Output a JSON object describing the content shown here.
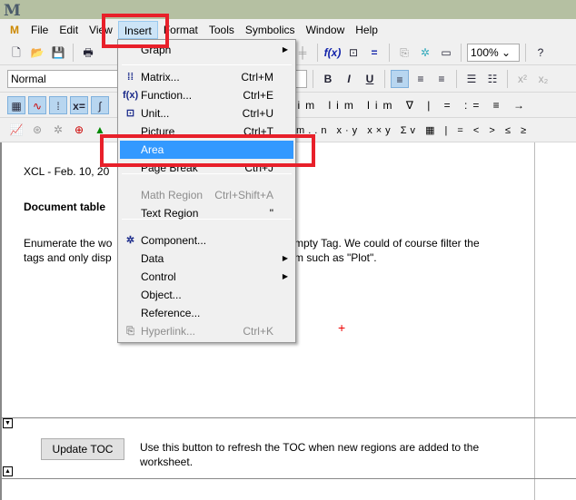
{
  "app": {
    "logo": "M"
  },
  "menubar": [
    "File",
    "Edit",
    "View",
    "Insert",
    "Format",
    "Tools",
    "Symbolics",
    "Window",
    "Help"
  ],
  "toolbar": {
    "zoom": "100%",
    "style": "Normal"
  },
  "insert_menu": [
    {
      "label": "Graph",
      "shortcut": "",
      "submenu": true,
      "disabled": false
    },
    {
      "label": "Matrix...",
      "shortcut": "Ctrl+M",
      "icon": "matrix-icon",
      "disabled": false
    },
    {
      "label": "Function...",
      "shortcut": "Ctrl+E",
      "icon": "function-icon",
      "disabled": false
    },
    {
      "label": "Unit...",
      "shortcut": "Ctrl+U",
      "icon": "unit-icon",
      "disabled": false
    },
    {
      "label": "Picture",
      "shortcut": "Ctrl+T",
      "disabled": false
    },
    {
      "label": "Area",
      "shortcut": "",
      "highlighted": true,
      "disabled": false
    },
    {
      "label": "Page Break",
      "shortcut": "Ctrl+J",
      "disabled": false
    },
    {
      "label": "Math Region",
      "shortcut": "Ctrl+Shift+A",
      "disabled": true
    },
    {
      "label": "Text Region",
      "shortcut": "\"",
      "disabled": false
    },
    {
      "label": "Component...",
      "shortcut": "",
      "icon": "component-icon",
      "disabled": false
    },
    {
      "label": "Data",
      "submenu": true,
      "disabled": false
    },
    {
      "label": "Control",
      "submenu": true,
      "disabled": false
    },
    {
      "label": "Object...",
      "shortcut": "",
      "disabled": false
    },
    {
      "label": "Reference...",
      "shortcut": "",
      "disabled": false
    },
    {
      "label": "Hyperlink...",
      "shortcut": "Ctrl+K",
      "icon": "hyperlink-icon",
      "disabled": true
    }
  ],
  "document": {
    "date": "XCL - Feb. 10, 20",
    "heading": "Document table",
    "para_left_1": "Enumerate the wo",
    "para_right_1": "mpty Tag. We could of course filter the",
    "para_left_2": "tags and only disp",
    "para_right_2": "m such as \"Plot\".",
    "button": "Update TOC",
    "button_desc": "Use this button to refresh the TOC when new regions are added to the worksheet."
  },
  "colors": {
    "highlight": "#3399ff",
    "annotation": "#e8202a"
  }
}
